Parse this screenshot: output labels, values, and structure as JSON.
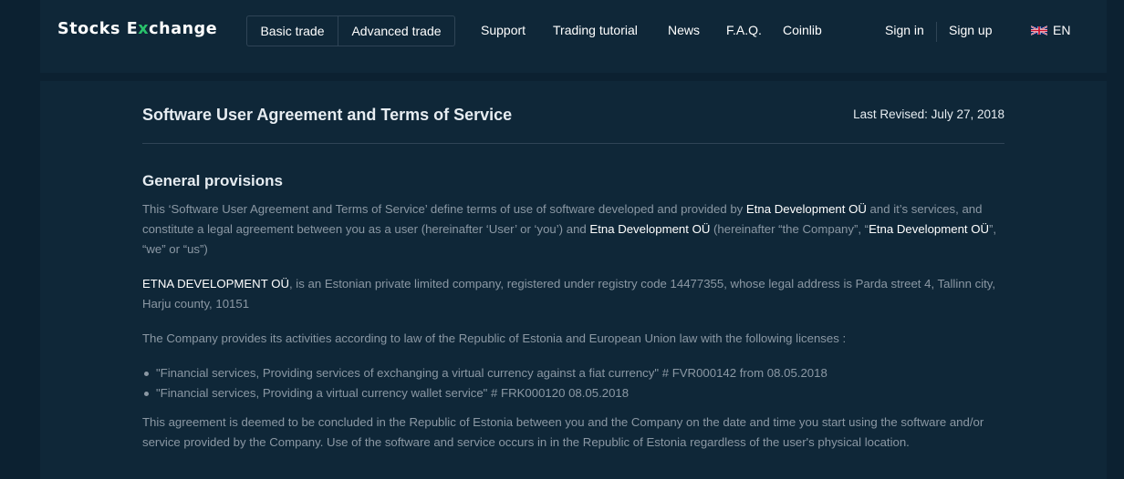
{
  "header": {
    "logo_pre": "Stocks E",
    "logo_x": "x",
    "logo_post": "change",
    "trade_buttons": [
      "Basic trade",
      "Advanced trade"
    ],
    "nav": [
      "Support",
      "Trading tutorial",
      "News",
      "F.A.Q.",
      "Coinlib"
    ],
    "sign_in": "Sign in",
    "sign_up": "Sign up",
    "lang": "EN",
    "lang_icon": "uk-flag-icon"
  },
  "doc": {
    "title": "Software User Agreement and Terms of Service",
    "last_revised": "Last Revised: July 27, 2018",
    "section_title": "General provisions",
    "p1": {
      "a": "This ‘Software User Agreement and Terms of Service’ define terms of use of software developed and provided by ",
      "b": "Etna Development OÜ",
      "c": " and it’s services, and constitute a legal agreement between you as a user (hereinafter ‘User’ or ‘you’) and ",
      "d": "Etna Development OÜ",
      "e": " (hereinafter “the Company”, “",
      "f": "Etna Development OÜ",
      "g": "”, “we” or “us”)"
    },
    "p2": {
      "a": "ETNA DEVELOPMENT OÜ",
      "b": ", is an Estonian private limited company, registered under registry code 14477355, whose legal address is Parda street 4, Tallinn city, Harju county, 10151"
    },
    "p3": "The Company provides its activities according to law of the Republic of Estonia and European Union law with the following licenses :",
    "licenses": [
      "\"Financial services, Providing services of exchanging a virtual currency against a fiat currency\" # FVR000142 from 08.05.2018",
      "\"Financial services, Providing a virtual currency wallet service\" # FRK000120 08.05.2018"
    ],
    "p4": "This agreement is deemed to be concluded in the Republic of Estonia between you and the Company on the date and time you start using the software and/or service provided by the Company. Use of the software and service occurs in in the Republic of Estonia regardless of the user's physical location."
  },
  "colors": {
    "background": "#0c2131",
    "panel": "#0f2738",
    "logo_accent": "#29c26b",
    "body_text": "#8b98a4",
    "heading_text": "#e6ecf1"
  }
}
